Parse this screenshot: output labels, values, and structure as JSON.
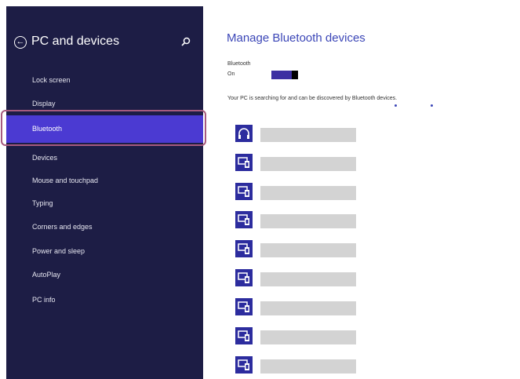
{
  "sidebar": {
    "title": "PC and devices",
    "items": [
      {
        "label": "Lock screen"
      },
      {
        "label": "Display"
      },
      {
        "label": "Bluetooth",
        "selected": true
      },
      {
        "label": "Devices"
      },
      {
        "label": "Mouse and touchpad"
      },
      {
        "label": "Typing"
      },
      {
        "label": "Corners and edges"
      },
      {
        "label": "Power and sleep"
      },
      {
        "label": "AutoPlay"
      },
      {
        "label": "PC info"
      }
    ]
  },
  "main": {
    "title": "Manage Bluetooth devices",
    "bluetooth_label": "Bluetooth",
    "bluetooth_state": "On",
    "status_message": "Your PC is searching for and can be discovered by Bluetooth devices.",
    "devices": [
      {
        "icon": "headphones-icon"
      },
      {
        "icon": "device-icon"
      },
      {
        "icon": "device-icon"
      },
      {
        "icon": "device-icon"
      },
      {
        "icon": "device-icon"
      },
      {
        "icon": "device-icon"
      },
      {
        "icon": "device-icon"
      },
      {
        "icon": "device-icon"
      },
      {
        "icon": "device-icon"
      }
    ]
  },
  "colors": {
    "sidebar_bg": "#1d1d45",
    "selected_bg": "#4b3ad2",
    "accent": "#3b46b7",
    "highlight_frame": "#a75a7e"
  }
}
